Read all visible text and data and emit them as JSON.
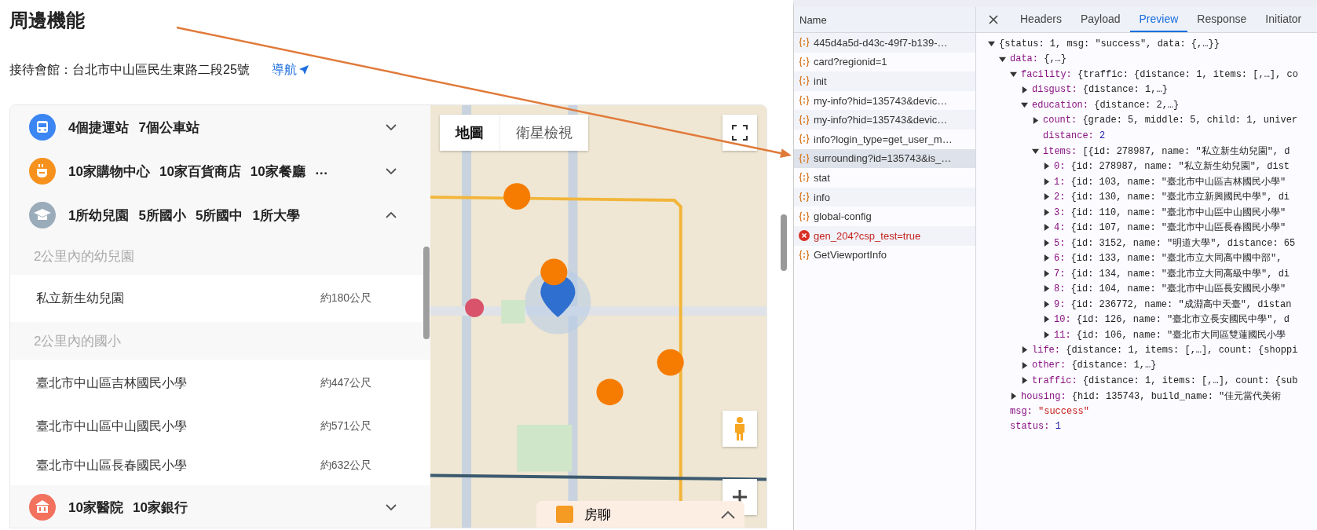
{
  "page": {
    "title": "周邊機能",
    "address": "接待會館：台北市中山區民生東路二段25號",
    "nav_link": "導航"
  },
  "categories": [
    {
      "kind": "traffic",
      "color": "#3b86f2",
      "expanded": false,
      "summary": [
        "4個捷運站",
        "7個公車站"
      ]
    },
    {
      "kind": "life",
      "color": "#f7911d",
      "expanded": false,
      "summary": [
        "10家購物中心",
        "10家百貨商店",
        "10家餐廳",
        "…"
      ]
    },
    {
      "kind": "education",
      "color": "#9aabba",
      "expanded": true,
      "summary": [
        "1所幼兒園",
        "5所國小",
        "5所國中",
        "1所大學"
      ],
      "groups": [
        {
          "heading": "2公里內的幼兒園",
          "items": [
            {
              "name": "私立新生幼兒園",
              "distance": "約180公尺"
            }
          ]
        },
        {
          "heading": "2公里內的國小",
          "items": [
            {
              "name": "臺北市中山區吉林國民小學",
              "distance": "約447公尺"
            },
            {
              "name": "臺北市中山區中山國民小學",
              "distance": "約571公尺"
            },
            {
              "name": "臺北市中山區長春國民小學",
              "distance": "約632公尺"
            }
          ]
        }
      ]
    },
    {
      "kind": "other",
      "color": "#f2725e",
      "expanded": false,
      "summary": [
        "10家醫院",
        "10家銀行"
      ]
    }
  ],
  "map": {
    "kind": "picture",
    "tabs": [
      {
        "label": "地圖",
        "selected": true
      },
      {
        "label": "衛星檢視",
        "selected": false
      }
    ],
    "chat_bar": {
      "label": "房聊"
    }
  },
  "devtools": {
    "name_header": "Name",
    "requests": [
      {
        "name": "445d4a5d-d43c-49f7-b139-…",
        "kind": "fetch",
        "selected": false
      },
      {
        "name": "card?regionid=1",
        "kind": "fetch",
        "selected": false
      },
      {
        "name": "init",
        "kind": "fetch",
        "selected": false
      },
      {
        "name": "my-info?hid=135743&devic…",
        "kind": "fetch",
        "selected": false
      },
      {
        "name": "my-info?hid=135743&devic…",
        "kind": "fetch",
        "selected": false
      },
      {
        "name": "info?login_type=get_user_m…",
        "kind": "fetch",
        "selected": false
      },
      {
        "name": "surrounding?id=135743&is_…",
        "kind": "fetch",
        "selected": true
      },
      {
        "name": "stat",
        "kind": "fetch",
        "selected": false
      },
      {
        "name": "info",
        "kind": "fetch",
        "selected": false
      },
      {
        "name": "global-config",
        "kind": "fetch",
        "selected": false
      },
      {
        "name": "gen_204?csp_test=true",
        "kind": "error",
        "selected": false
      },
      {
        "name": "GetViewportInfo",
        "kind": "fetch",
        "selected": false
      }
    ],
    "tabs": [
      {
        "label": "Headers",
        "selected": false
      },
      {
        "label": "Payload",
        "selected": false
      },
      {
        "label": "Preview",
        "selected": true
      },
      {
        "label": "Response",
        "selected": false
      },
      {
        "label": "Initiator",
        "selected": false
      }
    ],
    "preview": [
      {
        "kind": "object",
        "expanded": true,
        "value": "{status: 1, msg: \"success\", data: {,…}}",
        "children": [
          {
            "kind": "object",
            "expanded": true,
            "key": "data:",
            "value": "{,…}",
            "children": [
              {
                "kind": "object",
                "expanded": true,
                "key": "facility:",
                "value": "{traffic: {distance: 1, items: [,…], co",
                "children": [
                  {
                    "kind": "object",
                    "expanded": false,
                    "key": "disgust:",
                    "value": "{distance: 1,…}"
                  },
                  {
                    "kind": "object",
                    "expanded": true,
                    "key": "education:",
                    "value": "{distance: 2,…}",
                    "children": [
                      {
                        "kind": "object",
                        "expanded": false,
                        "key": "count:",
                        "value": "{grade: 5, middle: 5, child: 1, univer"
                      },
                      {
                        "kind": "number",
                        "key": "distance:",
                        "value": "2"
                      },
                      {
                        "kind": "object",
                        "expanded": true,
                        "key": "items:",
                        "value": "[{id: 278987, name: \"私立新生幼兒園\", d",
                        "children": [
                          {
                            "kind": "object",
                            "expanded": false,
                            "key": "0:",
                            "value": "{id: 278987, name: \"私立新生幼兒園\", dist"
                          },
                          {
                            "kind": "object",
                            "expanded": false,
                            "key": "1:",
                            "value": "{id: 103, name: \"臺北市中山區吉林國民小學\""
                          },
                          {
                            "kind": "object",
                            "expanded": false,
                            "key": "2:",
                            "value": "{id: 130, name: \"臺北市立新興國民中學\", di"
                          },
                          {
                            "kind": "object",
                            "expanded": false,
                            "key": "3:",
                            "value": "{id: 110, name: \"臺北市中山區中山國民小學\""
                          },
                          {
                            "kind": "object",
                            "expanded": false,
                            "key": "4:",
                            "value": "{id: 107, name: \"臺北市中山區長春國民小學\""
                          },
                          {
                            "kind": "object",
                            "expanded": false,
                            "key": "5:",
                            "value": "{id: 3152, name: \"明道大學\", distance: 65"
                          },
                          {
                            "kind": "object",
                            "expanded": false,
                            "key": "6:",
                            "value": "{id: 133, name: \"臺北市立大同高中國中部\","
                          },
                          {
                            "kind": "object",
                            "expanded": false,
                            "key": "7:",
                            "value": "{id: 134, name: \"臺北市立大同高級中學\", di"
                          },
                          {
                            "kind": "object",
                            "expanded": false,
                            "key": "8:",
                            "value": "{id: 104, name: \"臺北市中山區長安國民小學\""
                          },
                          {
                            "kind": "object",
                            "expanded": false,
                            "key": "9:",
                            "value": "{id: 236772, name: \"成淵高中天臺\", distan"
                          },
                          {
                            "kind": "object",
                            "expanded": false,
                            "key": "10:",
                            "value": "{id: 126, name: \"臺北市立長安國民中學\", d"
                          },
                          {
                            "kind": "object",
                            "expanded": false,
                            "key": "11:",
                            "value": "{id: 106, name: \"臺北市大同區雙蓮國民小學"
                          }
                        ]
                      }
                    ]
                  },
                  {
                    "kind": "object",
                    "expanded": false,
                    "key": "life:",
                    "value": "{distance: 1, items: [,…], count: {shoppi"
                  },
                  {
                    "kind": "object",
                    "expanded": false,
                    "key": "other:",
                    "value": "{distance: 1,…}"
                  },
                  {
                    "kind": "object",
                    "expanded": false,
                    "key": "traffic:",
                    "value": "{distance: 1, items: [,…], count: {sub"
                  }
                ]
              },
              {
                "kind": "object",
                "expanded": false,
                "key": "housing:",
                "value": "{hid: 135743, build_name: \"佳元當代美術"
              }
            ]
          },
          {
            "kind": "string",
            "key": "msg:",
            "value": "\"success\""
          },
          {
            "kind": "number",
            "key": "status:",
            "value": "1"
          }
        ]
      }
    ]
  }
}
